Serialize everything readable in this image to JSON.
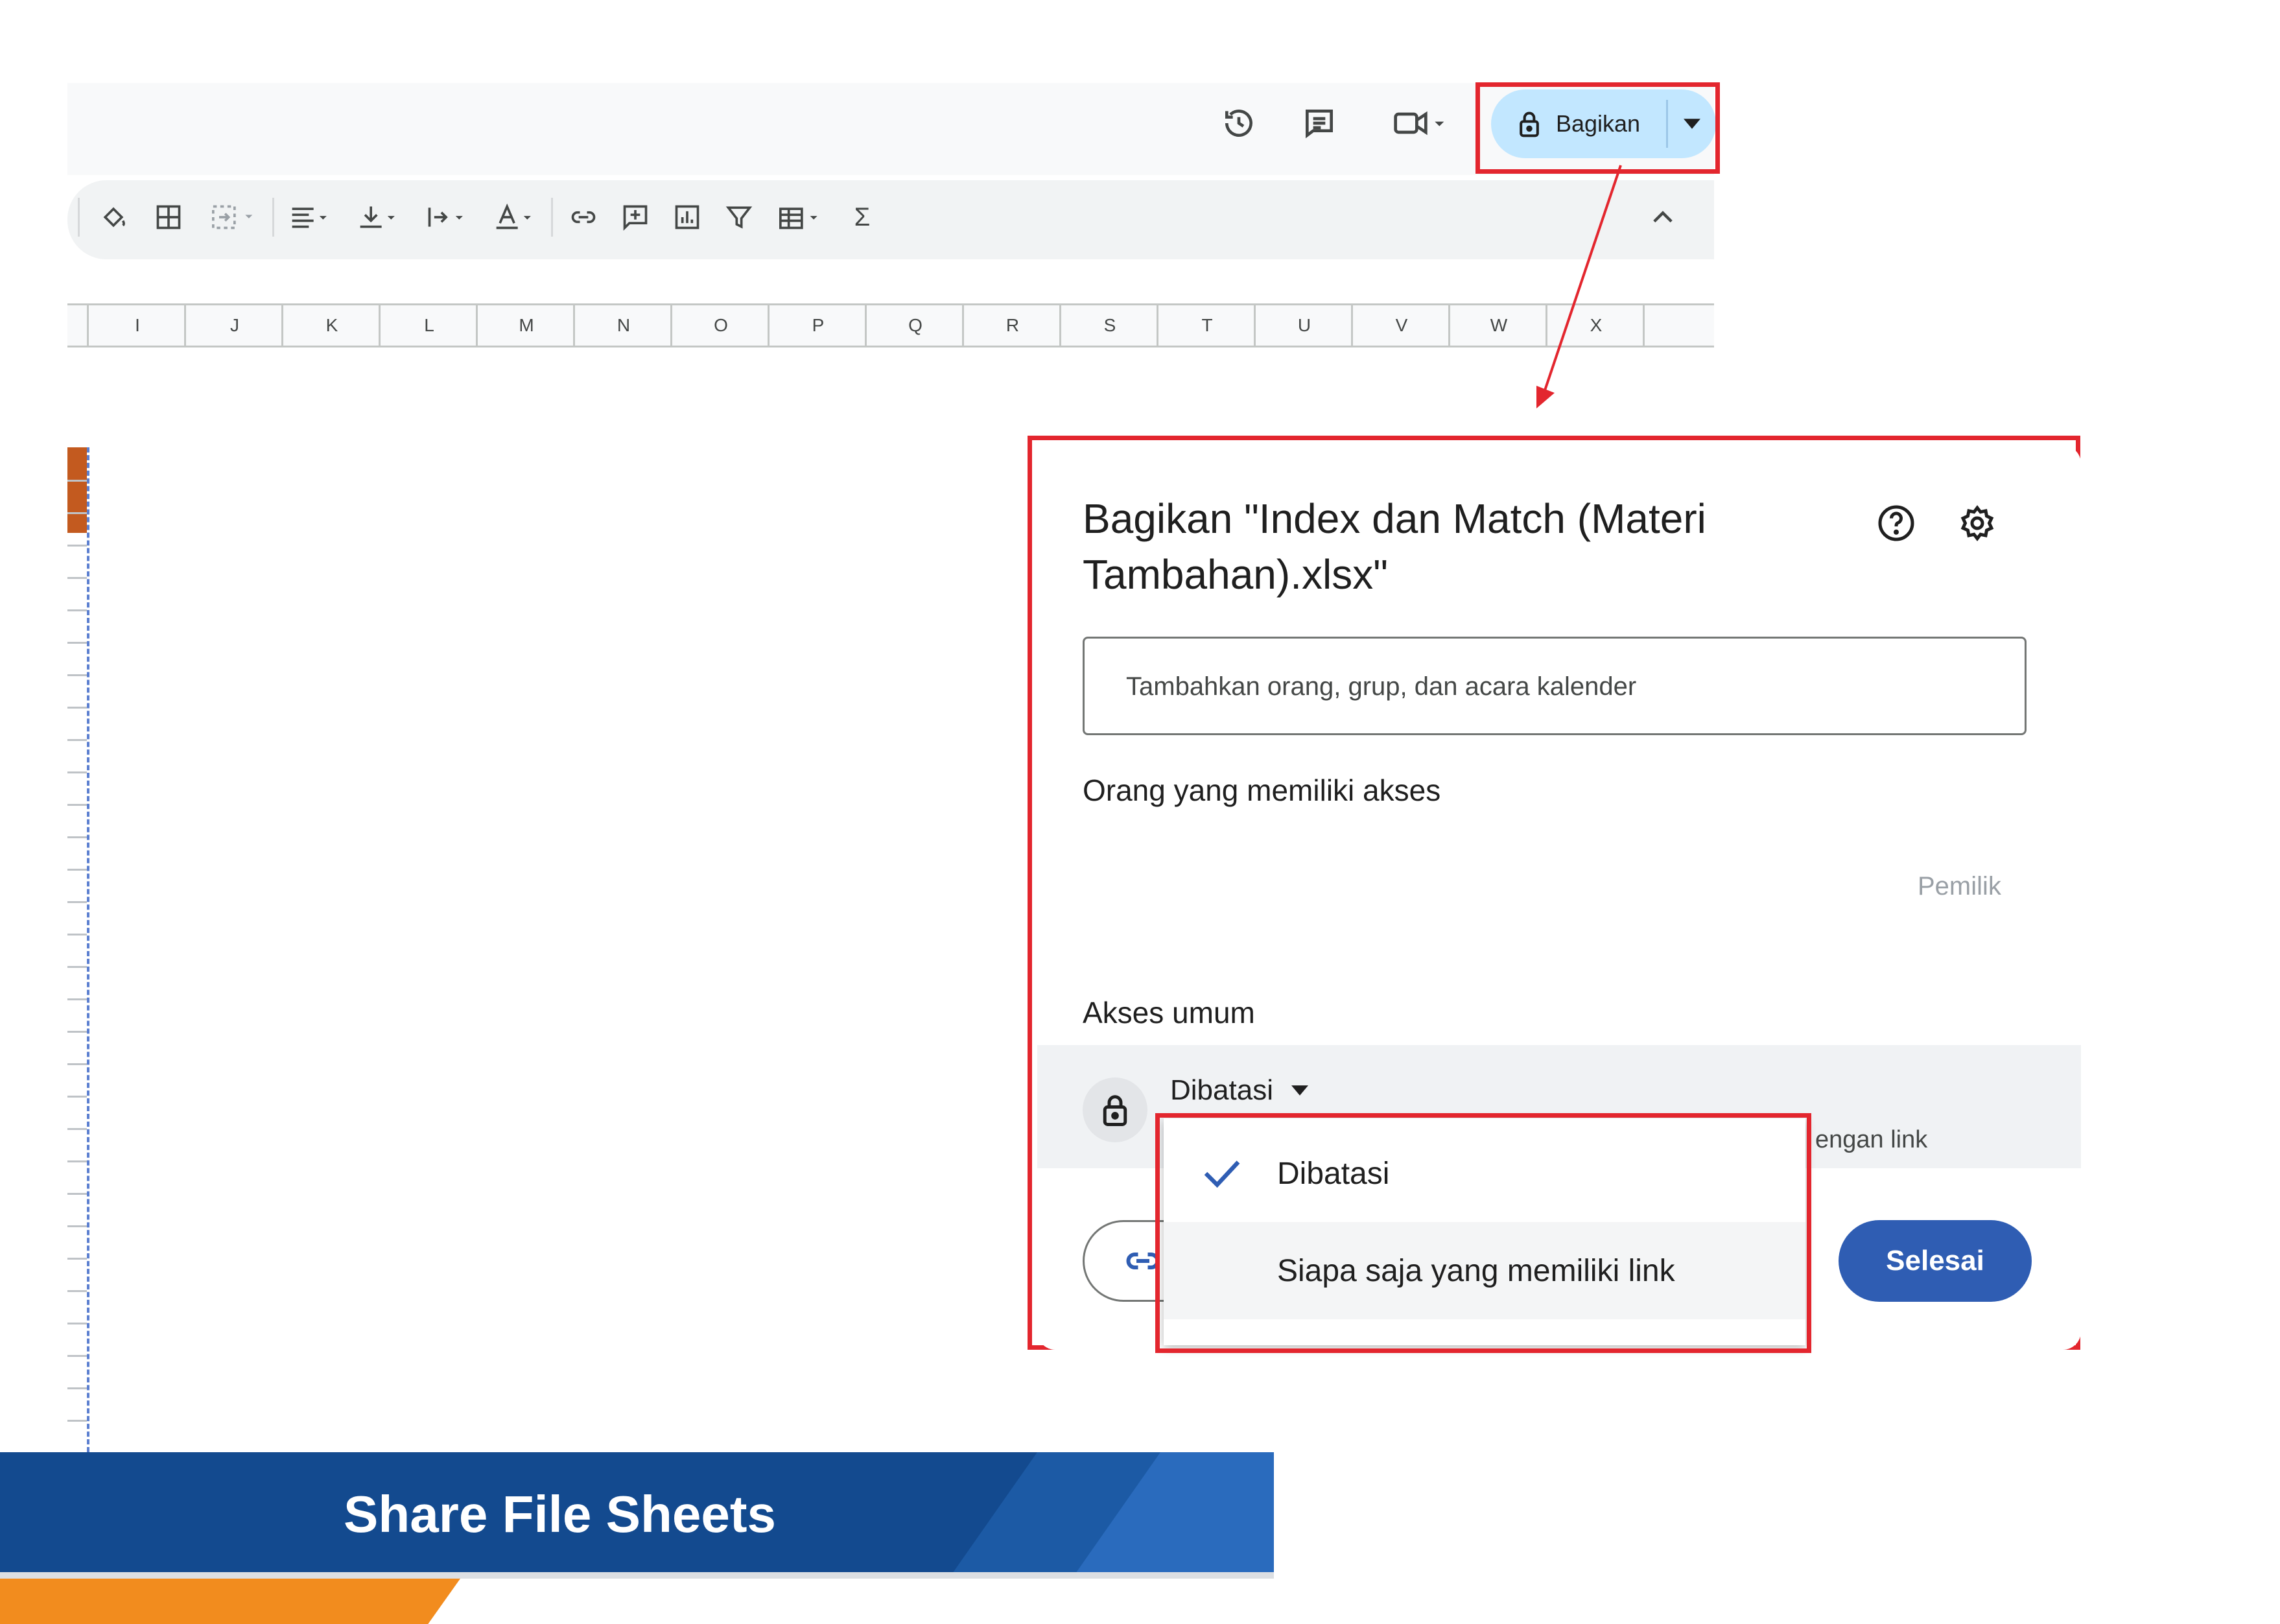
{
  "topbar": {
    "share_label": "Bagikan",
    "icons": [
      "history-icon",
      "comment-icon",
      "meet-icon",
      "lock-icon",
      "caret-down-icon"
    ]
  },
  "toolbar": {
    "icons": [
      "paint-fill-icon",
      "borders-icon",
      "merge-cells-icon",
      "align-icon",
      "valign-icon",
      "text-direction-icon",
      "text-color-icon",
      "link-icon",
      "insert-comment-icon",
      "insert-chart-icon",
      "filter-icon",
      "table-view-icon",
      "function-icon",
      "collapse-icon"
    ],
    "function_symbol": "Σ"
  },
  "columns": [
    "I",
    "J",
    "K",
    "L",
    "M",
    "N",
    "O",
    "P",
    "Q",
    "R",
    "S",
    "T",
    "U",
    "V",
    "W",
    "X"
  ],
  "dialog": {
    "title": "Bagikan \"Index dan Match (Materi Tambahan).xlsx\"",
    "add_placeholder": "Tambahkan orang, grup, dan acara kalender",
    "access_heading": "Orang yang memiliki akses",
    "owner_label": "Pemilik",
    "general_heading": "Akses umum",
    "general_selected": "Dibatasi",
    "general_desc_partial": "engan link",
    "done_label": "Selesai"
  },
  "menu": {
    "items": [
      {
        "label": "Dibatasi",
        "checked": true
      },
      {
        "label": "Siapa saja yang memiliki link",
        "checked": false
      }
    ]
  },
  "banner": {
    "title": "Share File Sheets"
  },
  "colors": {
    "highlight": "#e3262e",
    "share_pill": "#c2e7ff",
    "done_button": "#2f5db3",
    "banner": "#134a8f",
    "orange": "#f28c1e"
  }
}
